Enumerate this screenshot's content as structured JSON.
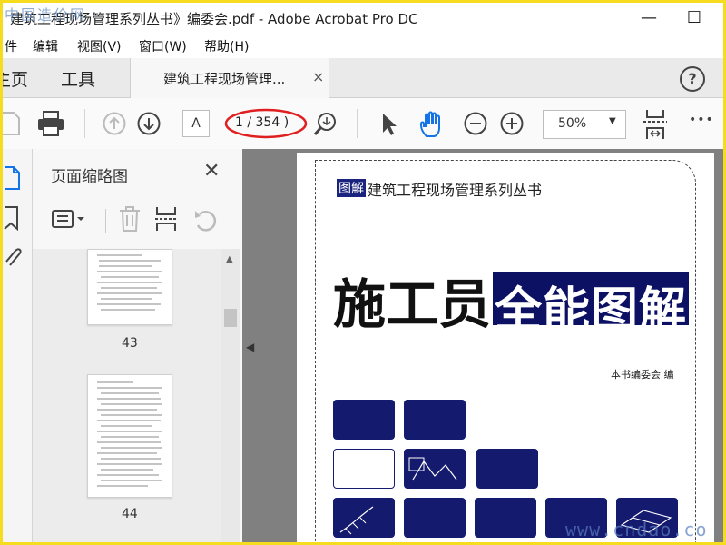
{
  "window": {
    "title": "建筑工程现场管理系列丛书》编委会.pdf - Adobe Acrobat Pro DC",
    "minimize": "—",
    "maximize": "☐",
    "watermark": "中国造价网"
  },
  "menu": {
    "items": [
      "件",
      "编辑",
      "视图(V)",
      "窗口(W)",
      "帮助(H)"
    ]
  },
  "tabs": {
    "home": "主页",
    "tools": "工具",
    "document_tab": "建筑工程现场管理...",
    "close": "×",
    "help": "?"
  },
  "toolbar": {
    "page_input": "A",
    "page_count": "1 / 354 )",
    "zoom": "50%",
    "zoom_arrow": "▼",
    "more": "•••"
  },
  "thumbnails": {
    "title": "页面缩略图",
    "close": "✕",
    "pages": [
      {
        "label": "43"
      },
      {
        "label": "44"
      }
    ]
  },
  "document": {
    "series_badge": "图解",
    "series_text": "建筑工程现场管理系列丛书",
    "title_main": "施工员",
    "title_highlight": "全能图解",
    "editor": "本书编委会  编",
    "site_watermark": "www.cndao.co"
  },
  "colors": {
    "accent_blue": "#1473e6",
    "cover_navy": "#0d1164",
    "annotation_red": "#e02020",
    "frame_yellow": "#f5dc1e"
  }
}
